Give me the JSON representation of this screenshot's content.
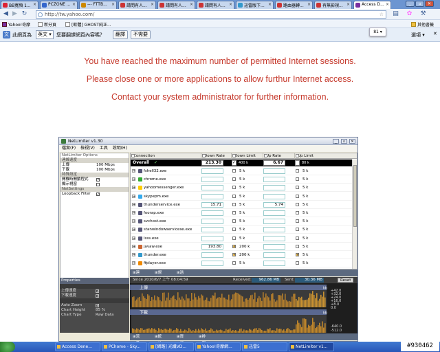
{
  "browser": {
    "tabs": [
      {
        "label": "BB寬頻 1...",
        "color": "#d23"
      },
      {
        "label": "PCZONE ...",
        "color": "#36c"
      },
      {
        "label": "--- FTTB...",
        "color": "#c80"
      },
      {
        "label": "請問有人...",
        "color": "#c33"
      },
      {
        "label": "請問有人...",
        "color": "#c33"
      },
      {
        "label": "請問有人...",
        "color": "#c33"
      },
      {
        "label": "迅雷版下...",
        "color": "#39c"
      },
      {
        "label": "路由器轉...",
        "color": "#c33"
      },
      {
        "label": "有無影視...",
        "color": "#c33"
      },
      {
        "label": "Access D...",
        "color": "#7a2fa0"
      }
    ],
    "url": "http://tw.yahoo.com/",
    "bookmarks": [
      "Yahoo!奇摩",
      "新分頁",
      "[軟體] GHOST純正...",
      "其他書籤"
    ],
    "translate": {
      "page_lang_label": "此網頁為",
      "lang": "英文",
      "question": "您要翻譯網頁內容嗎？",
      "translate_btn": "翻譯",
      "no_btn": "不需要",
      "options": "選項"
    },
    "badge": "81"
  },
  "message": {
    "line1": "You have reached the maximum number of permitted Internet sessions.",
    "line2": "Please close one or more applications to allow furthur Internet access.",
    "line3": "Contact your system administrator for further information."
  },
  "netlimiter": {
    "title": "NetLimiter v1.30",
    "menu": [
      "檔案(F)",
      "檢視(V)",
      "工具",
      "說明(H)"
    ],
    "left_header": "NetLimiter Options",
    "left_sections": [
      {
        "title": "連線速度",
        "rows": [
          {
            "k": "上傳",
            "v": "100 Mbps"
          },
          {
            "k": "下載",
            "v": "100 Mbps"
          }
        ]
      },
      {
        "title": "特殊設定",
        "rows": [
          {
            "k": "開機時開動程式",
            "cb": "✓"
          },
          {
            "k": "顯示視窗",
            "cb": ""
          }
        ]
      },
      {
        "title": "NetSettings",
        "rows": [
          {
            "k": "Loopback Filter",
            "cb": "✓"
          }
        ]
      }
    ],
    "columns": [
      "Connection",
      "Down Rate",
      "Down Limit",
      "Up Rate",
      "Up Limit"
    ],
    "overall": {
      "name": "Overall",
      "down_rate": "213.30",
      "down_limit": "400 k",
      "up_rate": "6.67",
      "up_limit": "80 k"
    },
    "rows": [
      {
        "name": "fshell32.exe",
        "down": "",
        "dlim": "5 k",
        "up": "",
        "ulim": "5 k",
        "dcb": "",
        "ucb": "",
        "color": "#557"
      },
      {
        "name": "chrome.exe",
        "down": "",
        "dlim": "5 k",
        "up": "",
        "ulim": "5 k",
        "dcb": "",
        "ucb": "",
        "color": "#3a3"
      },
      {
        "name": "yahoomessenger.exe",
        "down": "",
        "dlim": "5 k",
        "up": "",
        "ulim": "5 k",
        "dcb": "",
        "ucb": "",
        "color": "#fc0"
      },
      {
        "name": "skypepm.exe",
        "down": "",
        "dlim": "5 k",
        "up": "",
        "ulim": "5 k",
        "dcb": "",
        "ucb": "",
        "color": "#3ae"
      },
      {
        "name": "thunderservice.exe",
        "down": "15.71",
        "dlim": "5 k",
        "up": "5.74",
        "ulim": "5 k",
        "dcb": "",
        "ucb": "",
        "color": "#557"
      },
      {
        "name": "foorap.exe",
        "down": "",
        "dlim": "5 k",
        "up": "",
        "ulim": "5 k",
        "dcb": "",
        "ucb": "",
        "color": "#557"
      },
      {
        "name": "svchost.exe",
        "down": "",
        "dlim": "5 k",
        "up": "",
        "ulim": "5 k",
        "dcb": "",
        "ucb": "",
        "color": "#557"
      },
      {
        "name": "stanwindowservicese.exe",
        "down": "",
        "dlim": "5 k",
        "up": "",
        "ulim": "5 k",
        "dcb": "",
        "ucb": "",
        "color": "#557"
      },
      {
        "name": "lsss.exe",
        "down": "",
        "dlim": "5 k",
        "up": "",
        "ulim": "5 k",
        "dcb": "",
        "ucb": "",
        "color": "#557"
      },
      {
        "name": "javaw.exe",
        "down": "193.80",
        "dlim": "200 k",
        "up": "",
        "ulim": "5 k",
        "dcb": "✓",
        "ucb": "",
        "color": "#c63"
      },
      {
        "name": "thunder.exe",
        "down": "",
        "dlim": "200 k",
        "up": "",
        "ulim": "5 k",
        "dcb": "✓",
        "ucb": "✓",
        "color": "#39c"
      },
      {
        "name": "ffplayer.exe",
        "down": "",
        "dlim": "5 k",
        "up": "",
        "ulim": "5 k",
        "dcb": "",
        "ucb": "",
        "color": "#e80"
      }
    ],
    "tabs_top": [
      "連線",
      "規則",
      "過濾"
    ],
    "props_header": "Properties",
    "props": [
      {
        "group": "",
        "rows": [
          {
            "k": "上傳速度",
            "cb": "✓"
          },
          {
            "k": "下載速度",
            "cb": "✓"
          }
        ]
      },
      {
        "group": "",
        "rows": [
          {
            "k": "Auto Zoom",
            "cb": "✓"
          },
          {
            "k": "Chart Height",
            "v": "85 %"
          },
          {
            "k": "Chart Type",
            "v": "Raw Data"
          }
        ]
      }
    ],
    "graph": {
      "since": "Since 2010/6/7 上午 08:04:59",
      "received_label": "Received:",
      "received": "962.86 MB",
      "sent_label": "Sent:",
      "sent": "30.36 MB",
      "reset": "Reset",
      "up_label": "上傳",
      "down_label": "下載",
      "up_unit": "kb",
      "down_unit": "kb",
      "up_ticks": [
        "+42.0",
        "+32.0",
        "+24.0",
        "+16.0",
        "+8.0",
        "0.0"
      ],
      "down_ticks": [
        "-640.0",
        "-512.0"
      ]
    },
    "tabs_bottom": [
      "流量",
      "統計",
      "資訊",
      "排程"
    ]
  },
  "taskbar": {
    "items": [
      "Access Dene...",
      "PChome - Sky...",
      "[網路] 光纖VD...",
      "Yahoo!奇摩網...",
      "迅雷5",
      "NetLimiter v1..."
    ],
    "watermark": "#930462"
  }
}
